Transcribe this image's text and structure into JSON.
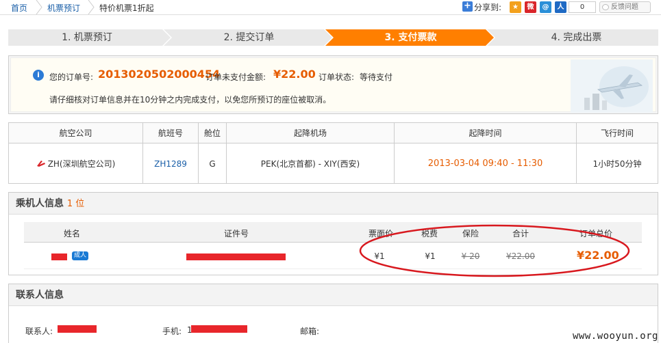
{
  "breadcrumb": {
    "home": "首页",
    "booking": "机票预订",
    "current": "特价机票1折起"
  },
  "share": {
    "label": "分享到:",
    "count": "0",
    "feedback": "反馈问题"
  },
  "steps": [
    {
      "label": "1. 机票预订",
      "active": false
    },
    {
      "label": "2. 提交订单",
      "active": false
    },
    {
      "label": "3. 支付票款",
      "active": true
    },
    {
      "label": "4. 完成出票",
      "active": false
    }
  ],
  "colors": {
    "accent": "#ff7f00",
    "step_inactive": "#e9e9e9",
    "price": "#e65c00",
    "link": "#1a5fa8",
    "annotation_red": "#d8181e"
  },
  "order": {
    "number_label": "您的订单号:",
    "number": "2013020502000454",
    "amount_label": "订单未支付金额:",
    "amount": "¥22.00",
    "status_label": "订单状态:",
    "status": "等待支付",
    "note": "请仔细核对订单信息并在10分钟之内完成支付，以免您所预订的座位被取消。"
  },
  "flight": {
    "headers": [
      "航空公司",
      "航班号",
      "舱位",
      "起降机场",
      "起降时间",
      "飞行时间"
    ],
    "airline": "ZH(深圳航空公司)",
    "flight_no": "ZH1289",
    "cabin": "G",
    "airports": "PEK(北京首都) - XIY(西安)",
    "time": "2013-03-04 09:40 - 11:30",
    "duration": "1小时50分钟"
  },
  "passenger": {
    "title": "乘机人信息",
    "count": "1 位",
    "headers": [
      "姓名",
      "证件号",
      "票面价",
      "税费",
      "保险",
      "合计",
      "订单总价"
    ],
    "type_badge": "成人",
    "fare": "¥1",
    "tax": "¥1",
    "insurance": "¥ 20",
    "subtotal": "¥22.00",
    "order_total": "¥22.00"
  },
  "contact": {
    "title": "联系人信息",
    "name_label": "联系人:",
    "phone_label": "手机:",
    "phone_prefix": "1",
    "email_label": "邮箱:"
  },
  "watermark": "www.wooyun.org"
}
